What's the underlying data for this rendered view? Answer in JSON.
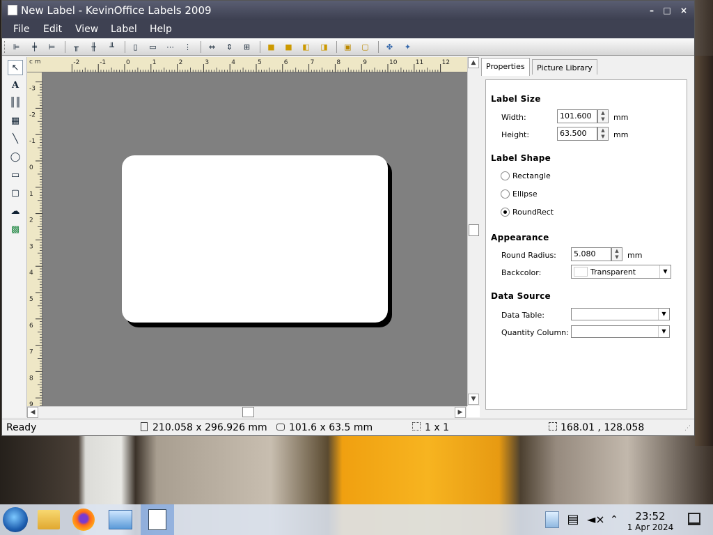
{
  "window": {
    "title": "New Label - KevinOffice Labels 2009",
    "controls": {
      "minimize": "–",
      "maximize": "□",
      "close": "×"
    }
  },
  "menu": {
    "file": "File",
    "edit": "Edit",
    "view": "View",
    "label": "Label",
    "help": "Help"
  },
  "toolbar": {
    "icons": [
      "align-left-icon",
      "align-center-icon",
      "align-right-icon",
      "align-top-icon",
      "align-middle-icon",
      "align-bottom-icon",
      "same-width-icon",
      "same-height-icon",
      "space-horizontal-icon",
      "space-vertical-icon",
      "center-horizontal-icon",
      "center-vertical-icon",
      "group-icon",
      "bring-front-icon",
      "send-back-icon",
      "bring-forward-icon",
      "send-backward-icon",
      "lock-icon",
      "unlock-icon",
      "print-icon",
      "print-preview-icon"
    ]
  },
  "tools": [
    "pointer-icon",
    "text-icon",
    "barcode-icon",
    "qrcode-icon",
    "line-icon",
    "ellipse-icon",
    "rectangle-icon",
    "roundrect-icon",
    "freeform-icon",
    "picture-icon"
  ],
  "ruler": {
    "unit": "c m",
    "top_ticks": [
      "-2",
      "-1",
      "0",
      "1",
      "2",
      "3",
      "4",
      "5",
      "6",
      "7",
      "8",
      "9",
      "10",
      "11",
      "12"
    ],
    "left_ticks": [
      "-3",
      "-2",
      "-1",
      "0",
      "1",
      "2",
      "3",
      "4",
      "5",
      "6",
      "7",
      "8",
      "9"
    ]
  },
  "panel": {
    "tabs": {
      "properties": "Properties",
      "picture_library": "Picture Library"
    },
    "label_size": {
      "title": "Label Size",
      "width_label": "Width:",
      "width_value": "101.600",
      "height_label": "Height:",
      "height_value": "63.500",
      "unit": "mm"
    },
    "label_shape": {
      "title": "Label Shape",
      "rectangle": "Rectangle",
      "ellipse": "Ellipse",
      "roundrect": "RoundRect",
      "selected": "RoundRect"
    },
    "appearance": {
      "title": "Appearance",
      "radius_label": "Round Radius:",
      "radius_value": "5.080",
      "unit": "mm",
      "backcolor_label": "Backcolor:",
      "backcolor_value": "Transparent"
    },
    "data_source": {
      "title": "Data Source",
      "table_label": "Data Table:",
      "table_value": "",
      "quantity_label": "Quantity Column:",
      "quantity_value": ""
    }
  },
  "status": {
    "ready": "Ready",
    "page_size": "210.058 x 296.926 mm",
    "label_size": "101.6 x 63.5 mm",
    "layout": "1 x 1",
    "cursor": "168.01 , 128.058"
  },
  "taskbar": {
    "time": "23:52",
    "date": "1 Apr 2024",
    "apps": [
      "start-button",
      "file-manager-icon",
      "firefox-icon",
      "control-panel-icon",
      "labels-app-icon"
    ],
    "tray": [
      "network-icon",
      "clipboard-icon",
      "volume-muted-icon",
      "tray-expand-icon",
      "show-desktop-icon"
    ]
  },
  "colors": {
    "titlebar": "#4a4d60",
    "menubar": "#3e4152",
    "workspace": "#808080",
    "ruler": "#eee7c6"
  }
}
